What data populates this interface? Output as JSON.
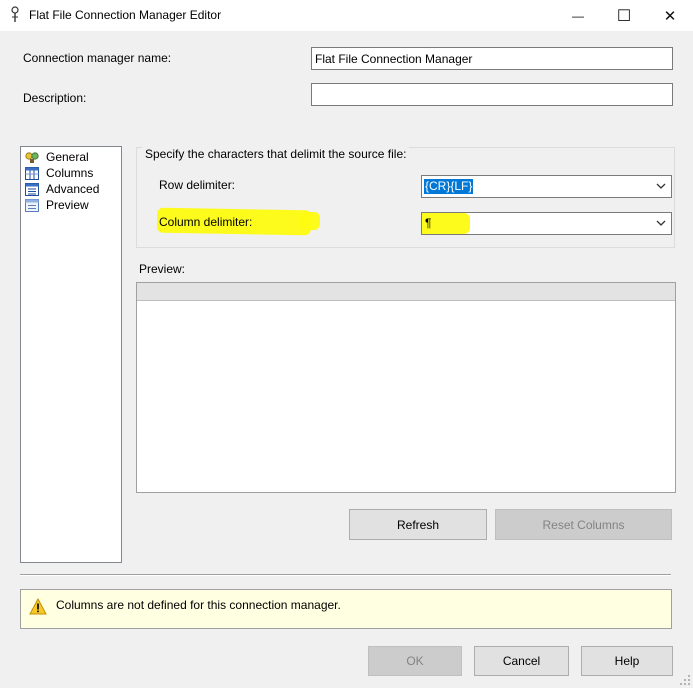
{
  "window": {
    "title": "Flat File Connection Manager Editor",
    "minimize_glyph": "—",
    "maximize_glyph": "☐",
    "close_glyph": "✕"
  },
  "form": {
    "name_label": "Connection manager name:",
    "name_value": "Flat File Connection Manager",
    "description_label": "Description:",
    "description_value": ""
  },
  "nav": {
    "items": [
      {
        "label": "General",
        "icon": "general-icon"
      },
      {
        "label": "Columns",
        "icon": "columns-icon"
      },
      {
        "label": "Advanced",
        "icon": "advanced-icon"
      },
      {
        "label": "Preview",
        "icon": "preview-icon"
      }
    ]
  },
  "delimiters": {
    "group_label": "Specify the characters that delimit the source file:",
    "row_label": "Row delimiter:",
    "row_value": "{CR}{LF}",
    "column_label": "Column delimiter:",
    "column_value": "¶"
  },
  "preview": {
    "label": "Preview:"
  },
  "buttons": {
    "refresh": "Refresh",
    "reset_columns": "Reset Columns",
    "ok": "OK",
    "cancel": "Cancel",
    "help": "Help"
  },
  "message": {
    "text": "Columns are not defined for this connection manager."
  },
  "colors": {
    "selection": "#0078d7",
    "highlighter": "#fdfb10",
    "message_background": "#ffffe1"
  }
}
